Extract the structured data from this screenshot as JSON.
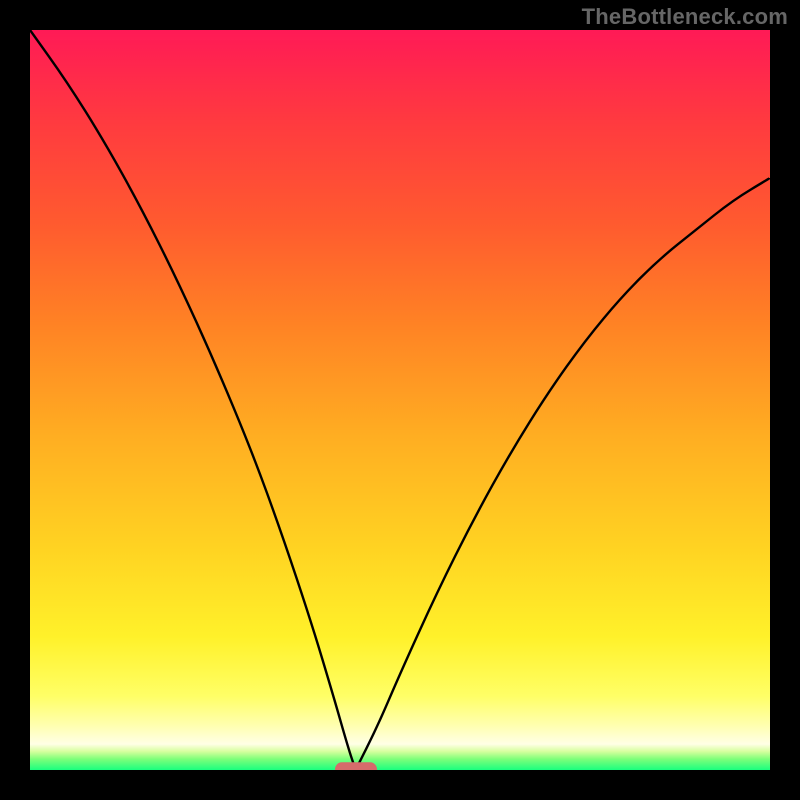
{
  "watermark": "TheBottleneck.com",
  "chart_data": {
    "type": "line",
    "title": "",
    "xlabel": "",
    "ylabel": "",
    "xlim": [
      0,
      100
    ],
    "ylim": [
      0,
      100
    ],
    "grid": false,
    "legend": false,
    "background": "rainbow-gradient red→yellow→green",
    "annotations": [
      {
        "name": "optimal-marker",
        "x": 44,
        "y": 0,
        "shape": "rounded-rect",
        "color": "#d66b6b"
      }
    ],
    "series": [
      {
        "name": "left-curve",
        "x": [
          0,
          5,
          10,
          15,
          20,
          25,
          30,
          34,
          38,
          41,
          43,
          44
        ],
        "values": [
          100,
          93,
          85,
          76,
          66,
          55,
          43,
          32,
          20,
          10,
          3,
          0
        ]
      },
      {
        "name": "right-curve",
        "x": [
          44,
          47,
          50,
          55,
          60,
          65,
          70,
          75,
          80,
          85,
          90,
          95,
          100
        ],
        "values": [
          0,
          6,
          13,
          24,
          34,
          43,
          51,
          58,
          64,
          69,
          73,
          77,
          80
        ]
      }
    ],
    "marker_x": 44
  }
}
